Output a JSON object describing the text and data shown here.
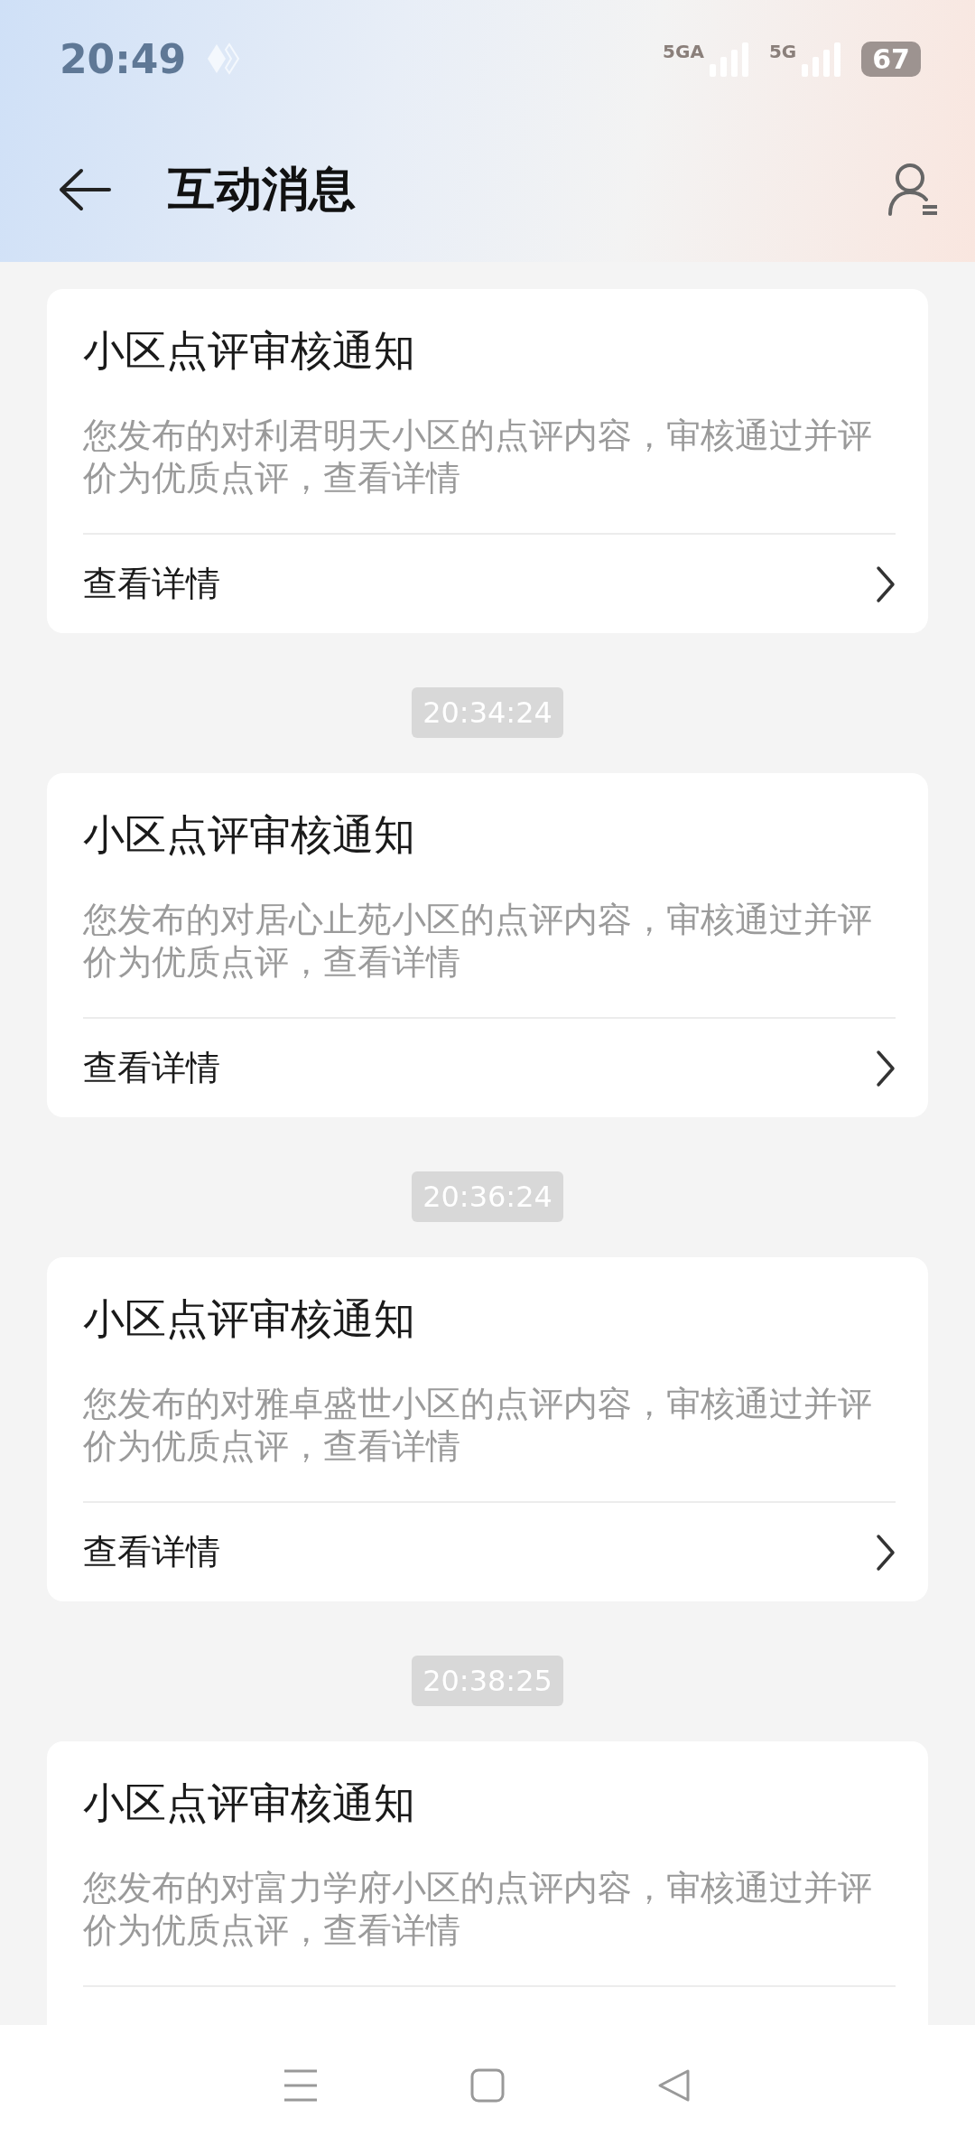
{
  "status_bar": {
    "time": "20:49",
    "networks": [
      "5GA",
      "5G"
    ],
    "battery": "67"
  },
  "header": {
    "title": "互动消息"
  },
  "messages": [
    {
      "title": "小区点评审核通知",
      "body": "您发布的对利君明天小区的点评内容，审核通过并评价为优质点评，查看详情",
      "action": "查看详情"
    },
    {
      "time": "20:34:24",
      "title": "小区点评审核通知",
      "body": "您发布的对居心止苑小区的点评内容，审核通过并评价为优质点评，查看详情",
      "action": "查看详情"
    },
    {
      "time": "20:36:24",
      "title": "小区点评审核通知",
      "body": "您发布的对雅卓盛世小区的点评内容，审核通过并评价为优质点评，查看详情",
      "action": "查看详情"
    },
    {
      "time": "20:38:25",
      "title": "小区点评审核通知",
      "body": "您发布的对富力学府小区的点评内容，审核通过并评价为优质点评，查看详情"
    }
  ]
}
